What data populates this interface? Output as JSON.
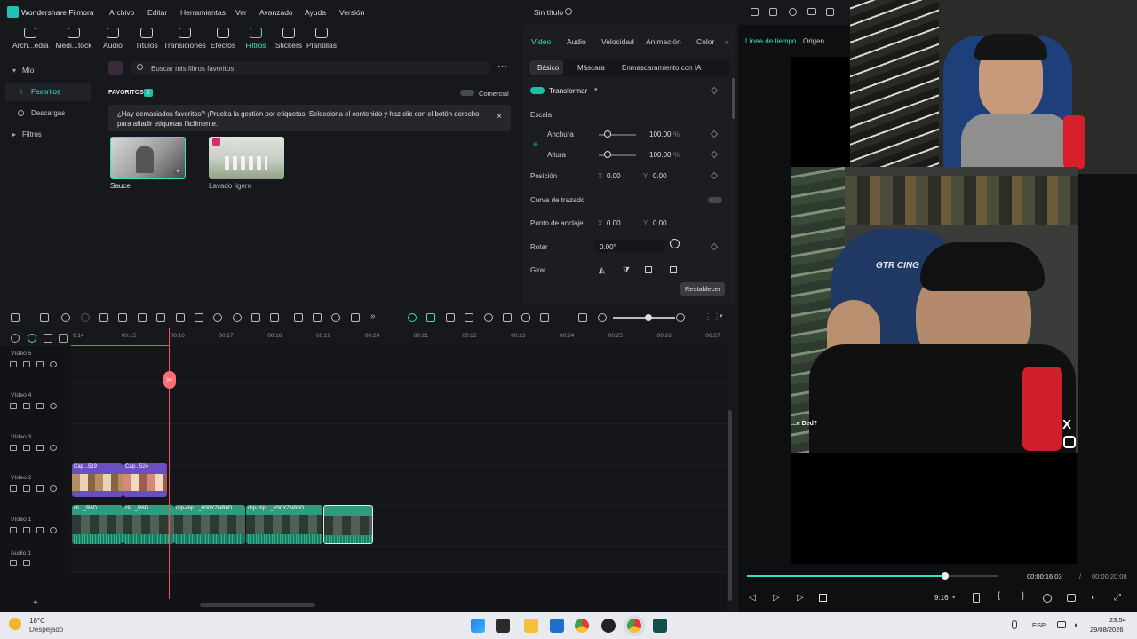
{
  "app": {
    "name": "Wondershare Filmora",
    "project_title": "Sin título"
  },
  "menu": [
    "Archivo",
    "Editar",
    "Herramientas",
    "Ver",
    "Avanzado",
    "Ayuda",
    "Versión"
  ],
  "toolbar": [
    "Arch...edia",
    "Medi...tock",
    "Audio",
    "Títulos",
    "Transiciones",
    "Efectos",
    "Filtros",
    "Stickers",
    "Plantillas"
  ],
  "toolbar_active": "Filtros",
  "sidebar": {
    "mio": "Mío",
    "favoritos": "Favoritos",
    "descargas": "Descargas",
    "filtros": "Filtros"
  },
  "library": {
    "search_placeholder": "Buscar mis filtros favoritos",
    "section_title": "FAVORITOS",
    "count": "2",
    "commercial": "Comercial",
    "banner": "¿Hay demasiados favoritos? ¡Prueba la gestión por etiquetas! Selecciona el contenido y haz clic con el botón derecho para añadir etiquetas fácilmente.",
    "items": [
      {
        "name": "Sauce"
      },
      {
        "name": "Lavado ligero"
      }
    ]
  },
  "properties": {
    "tabs": [
      "Vídeo",
      "Audio",
      "Velocidad",
      "Animación",
      "Color"
    ],
    "subtabs": [
      "Básico",
      "Máscara",
      "Enmascaramiento con IA"
    ],
    "transform": "Transformar",
    "escala": "Escala",
    "anchura": "Anchura",
    "anchura_val": "100.00",
    "altura": "Altura",
    "altura_val": "100.00",
    "percent": "%",
    "posicion": "Posición",
    "pos_x": "0.00",
    "pos_y": "0.00",
    "x_label": "X",
    "y_label": "Y",
    "curva": "Curva de trazado",
    "anclaje": "Punto de anclaje",
    "anc_x": "0.00",
    "anc_y": "0.00",
    "rotar": "Rotar",
    "rot_val": "0.00°",
    "girar": "Girar",
    "reset": "Restablecer"
  },
  "player": {
    "tabs": [
      "Línea de tiempo",
      "Origen"
    ],
    "current_time": "00:00:16:03",
    "separator": "/",
    "total_time": "00:00:20:08",
    "ratio": "9:16",
    "progress": 0.7907
  },
  "timeline": {
    "ruler": [
      "0:14",
      "00:15",
      "00:16",
      "00:17",
      "00:18",
      "00:19",
      "00:20",
      "00:21",
      "00:22",
      "00:23",
      "00:24",
      "00:25",
      "00:26",
      "00:27"
    ],
    "tracks": [
      "Vídeo 5",
      "Vídeo 4",
      "Vídeo 3",
      "Vídeo 2",
      "Vídeo 1",
      "Audio 1"
    ],
    "v2_clips": [
      "Cap...519",
      "Cap...524"
    ],
    "v1_clips": [
      "cli..._R6D",
      "cli..._R6D",
      "clip-clip..._H30YZNR6D",
      "clip-clip..._H30YZNR6D"
    ]
  },
  "webcam": {
    "chair_text": "GTR CING",
    "caption": "...e Ded?"
  },
  "taskbar": {
    "temp": "18°C",
    "weather": "Despejado",
    "lang": "ESP",
    "time": "23:54",
    "date": "29/08/2026"
  },
  "colors": {
    "accent": "#34e0c6",
    "bg": "#17181b",
    "playhead": "#ff4d5e",
    "video_clip": "#2f9b7f",
    "sub_clip": "#5a3ea8"
  }
}
